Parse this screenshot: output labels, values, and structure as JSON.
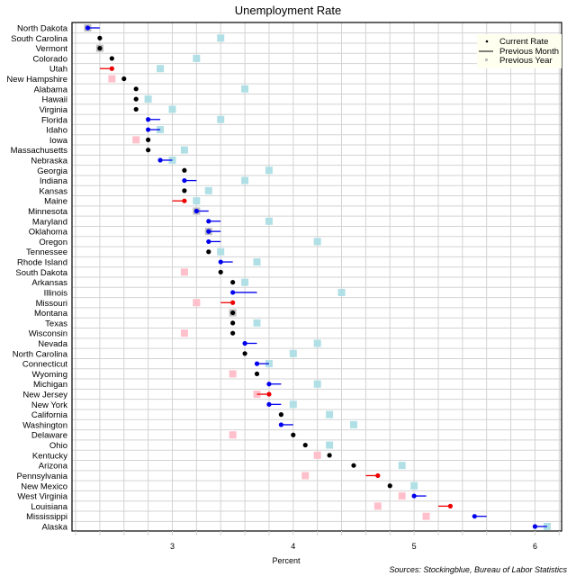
{
  "chart_data": {
    "type": "scatter",
    "title": "Unemployment Rate",
    "xlabel": "Percent",
    "ylabel": "",
    "source": "Sources: Stockingblue, Bureau of Labor Statistics",
    "xlim": [
      2.17,
      6.22
    ],
    "x_ticks": [
      3,
      4,
      5,
      6
    ],
    "x_tick_labels": [
      "3",
      "4",
      "5",
      "6"
    ],
    "grid": true,
    "legend": {
      "position": "top-right",
      "entries": [
        {
          "label": "Current Rate",
          "marker": "dot"
        },
        {
          "label": "Previous Month",
          "marker": "line"
        },
        {
          "label": "Previous Year",
          "marker": "square"
        }
      ]
    },
    "colors": {
      "unchanged": "#000000",
      "improved": "#0000ee",
      "worsened": "#ee0000",
      "prev_year_worse": "#b0e0e6",
      "prev_year_better": "#ffc0cb",
      "prev_year_same": "#bebebe",
      "grid": "#d3d3d3",
      "legend_bg": "#fffff0"
    },
    "series": [
      {
        "state": "North Dakota",
        "current": 2.3,
        "previous_month": 2.4,
        "previous_year": 2.3
      },
      {
        "state": "South Carolina",
        "current": 2.4,
        "previous_month": 2.4,
        "previous_year": 3.4
      },
      {
        "state": "Vermont",
        "current": 2.4,
        "previous_month": 2.4,
        "previous_year": 2.4
      },
      {
        "state": "Colorado",
        "current": 2.5,
        "previous_month": 2.5,
        "previous_year": 3.2
      },
      {
        "state": "Utah",
        "current": 2.5,
        "previous_month": 2.4,
        "previous_year": 2.9
      },
      {
        "state": "New Hampshire",
        "current": 2.6,
        "previous_month": 2.6,
        "previous_year": 2.5
      },
      {
        "state": "Alabama",
        "current": 2.7,
        "previous_month": 2.7,
        "previous_year": 3.6
      },
      {
        "state": "Hawaii",
        "current": 2.7,
        "previous_month": 2.7,
        "previous_year": 2.8
      },
      {
        "state": "Virginia",
        "current": 2.7,
        "previous_month": 2.7,
        "previous_year": 3.0
      },
      {
        "state": "Florida",
        "current": 2.8,
        "previous_month": 2.9,
        "previous_year": 3.4
      },
      {
        "state": "Idaho",
        "current": 2.8,
        "previous_month": 2.9,
        "previous_year": 2.9
      },
      {
        "state": "Iowa",
        "current": 2.8,
        "previous_month": 2.8,
        "previous_year": 2.7
      },
      {
        "state": "Massachusetts",
        "current": 2.8,
        "previous_month": 2.8,
        "previous_year": 3.1
      },
      {
        "state": "Nebraska",
        "current": 2.9,
        "previous_month": 3.0,
        "previous_year": 3.0
      },
      {
        "state": "Georgia",
        "current": 3.1,
        "previous_month": 3.1,
        "previous_year": 3.8
      },
      {
        "state": "Indiana",
        "current": 3.1,
        "previous_month": 3.2,
        "previous_year": 3.6
      },
      {
        "state": "Kansas",
        "current": 3.1,
        "previous_month": 3.1,
        "previous_year": 3.3
      },
      {
        "state": "Maine",
        "current": 3.1,
        "previous_month": 3.0,
        "previous_year": 3.2
      },
      {
        "state": "Minnesota",
        "current": 3.2,
        "previous_month": 3.3,
        "previous_year": 3.2
      },
      {
        "state": "Maryland",
        "current": 3.3,
        "previous_month": 3.4,
        "previous_year": 3.8
      },
      {
        "state": "Oklahoma",
        "current": 3.3,
        "previous_month": 3.4,
        "previous_year": 3.3
      },
      {
        "state": "Oregon",
        "current": 3.3,
        "previous_month": 3.4,
        "previous_year": 4.2
      },
      {
        "state": "Tennessee",
        "current": 3.3,
        "previous_month": 3.3,
        "previous_year": 3.4
      },
      {
        "state": "Rhode Island",
        "current": 3.4,
        "previous_month": 3.5,
        "previous_year": 3.7
      },
      {
        "state": "South Dakota",
        "current": 3.4,
        "previous_month": 3.4,
        "previous_year": 3.1
      },
      {
        "state": "Arkansas",
        "current": 3.5,
        "previous_month": 3.5,
        "previous_year": 3.6
      },
      {
        "state": "Illinois",
        "current": 3.5,
        "previous_month": 3.7,
        "previous_year": 4.4
      },
      {
        "state": "Missouri",
        "current": 3.5,
        "previous_month": 3.4,
        "previous_year": 3.2
      },
      {
        "state": "Montana",
        "current": 3.5,
        "previous_month": 3.5,
        "previous_year": 3.5
      },
      {
        "state": "Texas",
        "current": 3.5,
        "previous_month": 3.5,
        "previous_year": 3.7
      },
      {
        "state": "Wisconsin",
        "current": 3.5,
        "previous_month": 3.5,
        "previous_year": 3.1
      },
      {
        "state": "Nevada",
        "current": 3.6,
        "previous_month": 3.7,
        "previous_year": 4.2
      },
      {
        "state": "North Carolina",
        "current": 3.6,
        "previous_month": 3.6,
        "previous_year": 4.0
      },
      {
        "state": "Connecticut",
        "current": 3.7,
        "previous_month": 3.8,
        "previous_year": 3.8
      },
      {
        "state": "Wyoming",
        "current": 3.7,
        "previous_month": 3.7,
        "previous_year": 3.5
      },
      {
        "state": "Michigan",
        "current": 3.8,
        "previous_month": 3.9,
        "previous_year": 4.2
      },
      {
        "state": "New Jersey",
        "current": 3.8,
        "previous_month": 3.7,
        "previous_year": 3.7
      },
      {
        "state": "New York",
        "current": 3.8,
        "previous_month": 3.9,
        "previous_year": 4.0
      },
      {
        "state": "California",
        "current": 3.9,
        "previous_month": 3.9,
        "previous_year": 4.3
      },
      {
        "state": "Washington",
        "current": 3.9,
        "previous_month": 4.0,
        "previous_year": 4.5
      },
      {
        "state": "Delaware",
        "current": 4.0,
        "previous_month": 4.0,
        "previous_year": 3.5
      },
      {
        "state": "Ohio",
        "current": 4.1,
        "previous_month": 4.1,
        "previous_year": 4.3
      },
      {
        "state": "Kentucky",
        "current": 4.3,
        "previous_month": 4.3,
        "previous_year": 4.2
      },
      {
        "state": "Arizona",
        "current": 4.5,
        "previous_month": 4.5,
        "previous_year": 4.9
      },
      {
        "state": "Pennsylvania",
        "current": 4.7,
        "previous_month": 4.6,
        "previous_year": 4.1
      },
      {
        "state": "New Mexico",
        "current": 4.8,
        "previous_month": 4.8,
        "previous_year": 5.0
      },
      {
        "state": "West Virginia",
        "current": 5.0,
        "previous_month": 5.1,
        "previous_year": 4.9
      },
      {
        "state": "Louisiana",
        "current": 5.3,
        "previous_month": 5.2,
        "previous_year": 4.7
      },
      {
        "state": "Mississippi",
        "current": 5.5,
        "previous_month": 5.6,
        "previous_year": 5.1
      },
      {
        "state": "Alaska",
        "current": 6.0,
        "previous_month": 6.1,
        "previous_year": 6.1
      }
    ]
  }
}
